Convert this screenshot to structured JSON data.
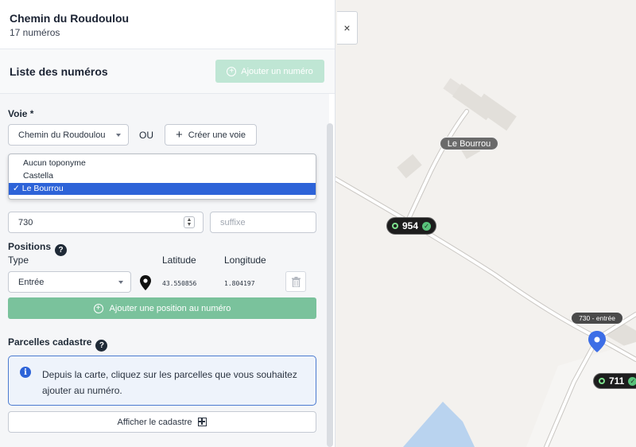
{
  "header": {
    "title": "Chemin du Roudoulou",
    "count": "17 numéros"
  },
  "list": {
    "title": "Liste des numéros",
    "add_button": "Ajouter un numéro"
  },
  "form": {
    "voie_label": "Voie *",
    "voie_select": "Chemin du Roudoulou",
    "or_text": "OU",
    "create_voie_button": "Créer une voie",
    "toponyme_options": [
      "Aucun toponyme",
      "Castella",
      "Le Bourrou"
    ],
    "toponyme_selected_index": 2,
    "checkmark": "✓",
    "numero_value": "730",
    "suffix_placeholder": "suffixe",
    "positions_label": "Positions",
    "type_header": "Type",
    "latitude_header": "Latitude",
    "longitude_header": "Longitude",
    "position_type": "Entrée",
    "latitude": "43.550856",
    "longitude": "1.804197",
    "add_position_button": "Ajouter une position au numéro",
    "parcelles_label": "Parcelles cadastre",
    "info_text": "Depuis la carte, cliquez sur les parcelles que vous souhaitez ajouter au numéro.",
    "cadastre_button": "Afficher le cadastre"
  },
  "map": {
    "close_label": "×",
    "place_label": "Le Bourrou",
    "numbers": [
      {
        "label": "954"
      },
      {
        "label": "711"
      }
    ],
    "marker_label": "730 - entrée",
    "marker_color": "#3d6ee6"
  },
  "colors": {
    "accent_green": "#7ac29c",
    "accent_blue": "#2d63d8"
  }
}
